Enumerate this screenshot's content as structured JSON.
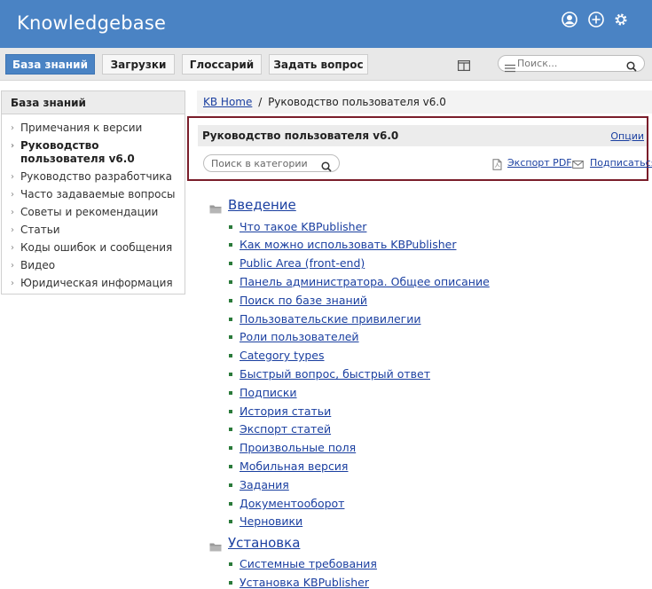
{
  "app": {
    "title": "Knowledgebase"
  },
  "nav": {
    "tabs": [
      "База знаний",
      "Загрузки",
      "Глоссарий",
      "Задать вопрос"
    ],
    "search_placeholder": "Поиск..."
  },
  "sidebar": {
    "title": "База знаний",
    "items": [
      "Примечания к версии",
      "Руководство пользователя v6.0",
      "Руководство разработчика",
      "Часто задаваемые вопросы",
      "Советы и рекомендации",
      "Статьи",
      "Коды ошибок и сообщения",
      "Видео",
      "Юридическая информация"
    ]
  },
  "breadcrumb": {
    "home": "KB Home",
    "separator": "/",
    "current": "Руководство пользователя v6.0"
  },
  "category": {
    "title": "Руководство пользователя v6.0",
    "options": "Опции",
    "search_placeholder": "Поиск в категории",
    "export_pdf": "Экспорт PDF",
    "subscribe": "Подписаться"
  },
  "sections": [
    {
      "title": "Введение",
      "articles": [
        "Что такое KBPublisher",
        "Как можно использовать KBPublisher",
        "Public Area (front-end)",
        "Панель администратора. Общее описание",
        "Поиск по базе знаний",
        "Пользовательские привилегии",
        "Роли пользователей",
        "Category types",
        "Быстрый вопрос, быстрый ответ",
        "Подписки",
        "История статьи",
        "Экспорт статей",
        "Произвольные поля",
        "Мобильная версия",
        "Задания",
        "Документооборот",
        "Черновики"
      ]
    },
    {
      "title": "Установка",
      "articles": [
        "Системные требования",
        "Установка KBPublisher"
      ]
    }
  ],
  "colors": {
    "header": "#4a83c4",
    "link": "#1a3fa0",
    "highlight_border": "#7a1d2a"
  }
}
